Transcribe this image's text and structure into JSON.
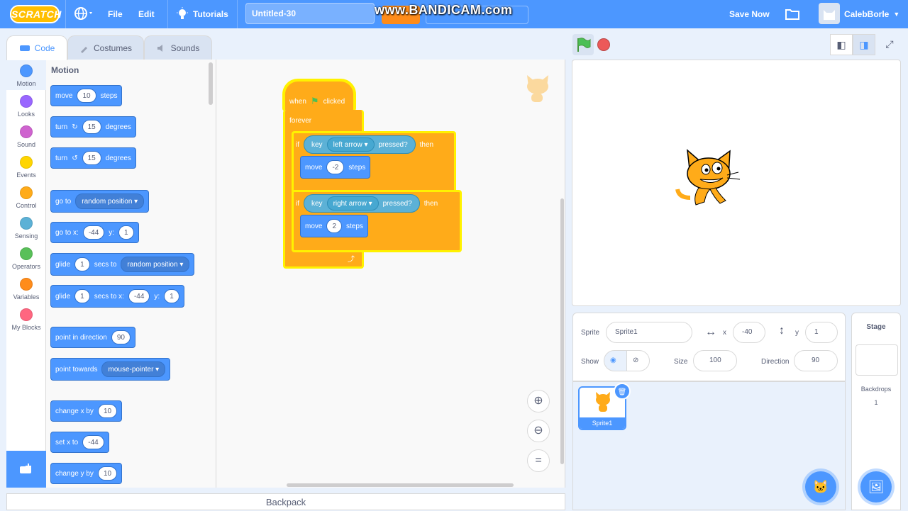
{
  "menubar": {
    "logo": "SCRATCH",
    "file": "File",
    "edit": "Edit",
    "tutorials": "Tutorials",
    "project_title": "Untitled-30",
    "watermark": "www.BANDICAM.com",
    "save_now": "Save Now",
    "username": "CalebBorle"
  },
  "tabs": {
    "code": "Code",
    "costumes": "Costumes",
    "sounds": "Sounds"
  },
  "categories": [
    {
      "label": "Motion",
      "color": "#4c97ff"
    },
    {
      "label": "Looks",
      "color": "#9966ff"
    },
    {
      "label": "Sound",
      "color": "#cf63cf"
    },
    {
      "label": "Events",
      "color": "#ffd500"
    },
    {
      "label": "Control",
      "color": "#ffab19"
    },
    {
      "label": "Sensing",
      "color": "#5cb1d6"
    },
    {
      "label": "Operators",
      "color": "#59c059"
    },
    {
      "label": "Variables",
      "color": "#ff8c1a"
    },
    {
      "label": "My Blocks",
      "color": "#ff6680"
    }
  ],
  "palette": {
    "title": "Motion",
    "move": {
      "a": "move",
      "v": "10",
      "b": "steps"
    },
    "turn_cw": {
      "a": "turn",
      "v": "15",
      "b": "degrees"
    },
    "turn_ccw": {
      "a": "turn",
      "v": "15",
      "b": "degrees"
    },
    "goto": {
      "a": "go to",
      "dd": "random position"
    },
    "goto_xy": {
      "a": "go to x:",
      "x": "-44",
      "b": "y:",
      "y": "1"
    },
    "glide": {
      "a": "glide",
      "v": "1",
      "b": "secs to",
      "dd": "random position"
    },
    "glide_xy": {
      "a": "glide",
      "v": "1",
      "b": "secs to x:",
      "x": "-44",
      "c": "y:",
      "y": "1"
    },
    "point_dir": {
      "a": "point in direction",
      "v": "90"
    },
    "point_towards": {
      "a": "point towards",
      "dd": "mouse-pointer"
    },
    "change_x": {
      "a": "change x by",
      "v": "10"
    },
    "set_x": {
      "a": "set x to",
      "v": "-44"
    },
    "change_y": {
      "a": "change y by",
      "v": "10"
    }
  },
  "script": {
    "when": "when",
    "clicked": "clicked",
    "forever": "forever",
    "if1": {
      "if": "if",
      "key": "key",
      "dd": "left arrow",
      "pressed": "pressed?",
      "then": "then"
    },
    "move1": {
      "a": "move",
      "v": "-2",
      "b": "steps"
    },
    "if2": {
      "if": "if",
      "key": "key",
      "dd": "right arrow",
      "pressed": "pressed?",
      "then": "then"
    },
    "move2": {
      "a": "move",
      "v": "2",
      "b": "steps"
    }
  },
  "backpack": "Backpack",
  "sprite_info": {
    "sprite_label": "Sprite",
    "sprite_name": "Sprite1",
    "x_label": "x",
    "x": "-40",
    "y_label": "y",
    "y": "1",
    "show_label": "Show",
    "size_label": "Size",
    "size": "100",
    "direction_label": "Direction",
    "direction": "90"
  },
  "sprite_tile": "Sprite1",
  "stage_pane": {
    "title": "Stage",
    "backdrops_label": "Backdrops",
    "backdrops_count": "1"
  }
}
